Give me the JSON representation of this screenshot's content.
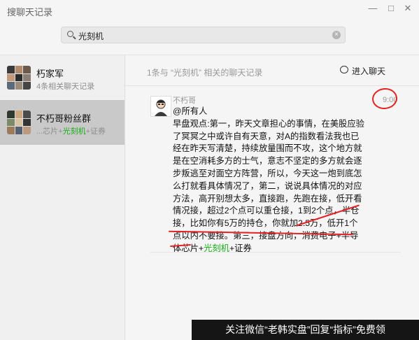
{
  "window": {
    "title": "搜聊天记录",
    "min_glyph": "—",
    "max_glyph": "□",
    "close_glyph": "✕"
  },
  "search": {
    "value": "光刻机",
    "clear_glyph": "×"
  },
  "chats": [
    {
      "name": "朽家军",
      "sub": "4条相关聊天记录"
    },
    {
      "name": "不朽哥粉丝群",
      "sub_prefix": "...芯片+",
      "sub_keyword": "光刻机",
      "sub_suffix": "+证券"
    }
  ],
  "main": {
    "summary": "1条与 “光刻机” 相关的聊天记录",
    "enter_chat": "进入聊天"
  },
  "message": {
    "sender": "不朽哥",
    "time": "9:00",
    "mention": "@所有人",
    "body": "早盘观点:第一，昨天文章担心的事情，在美股应验了冥冥之中或许自有天意，对A的指数看法我也已经在昨天写清楚，持续放量围而不攻，这个地方就是在空消耗多方的士气，意志不坚定的多方就会逐步叛逃至对面空方阵营，所以，今天这一炮到底怎么打就看具体情况了，第二，说说具体情况的对应方法，高开别想太多，直接跑，先跑在接，低开看情况接，超过2个点可以重仓接，1到2个点，半仓接，比如你有5万的持仓，你就加2.5万，低开1个点以内不要接。第三，接盘方向，消费电子+半导体芯片+",
    "keyword": "光刻机",
    "tail": "+证券"
  },
  "watermark": "关注微信“老韩实盘”回复“指标”免费领",
  "colors": {
    "highlight": "#1aad19",
    "annotation_red": "#e52222",
    "selected_bg": "#c9c9c9"
  }
}
